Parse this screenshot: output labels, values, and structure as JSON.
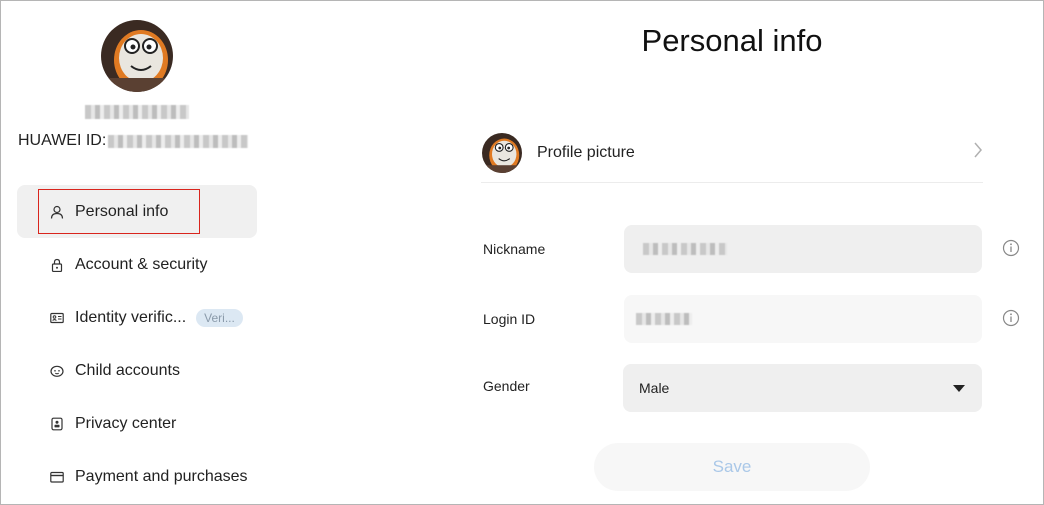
{
  "sidebar": {
    "huawei_id_label": "HUAWEI ID:",
    "items": [
      {
        "label": "Personal info",
        "icon": "person-icon",
        "active": true
      },
      {
        "label": "Account & security",
        "icon": "lock-icon"
      },
      {
        "label": "Identity verific...",
        "icon": "id-card-icon",
        "badge": "Veri..."
      },
      {
        "label": "Child accounts",
        "icon": "child-face-icon"
      },
      {
        "label": "Privacy center",
        "icon": "privacy-icon"
      },
      {
        "label": "Payment and purchases",
        "icon": "card-icon"
      }
    ]
  },
  "main": {
    "title": "Personal info",
    "profile_picture_label": "Profile picture",
    "fields": {
      "nickname": {
        "label": "Nickname"
      },
      "login_id": {
        "label": "Login ID"
      },
      "gender": {
        "label": "Gender",
        "value": "Male"
      }
    },
    "save_label": "Save"
  },
  "colors": {
    "active_item_bg": "#f0f0f0",
    "highlight_border": "#d9251d",
    "save_text": "#aac8e8",
    "badge_bg": "#dce8f3"
  }
}
